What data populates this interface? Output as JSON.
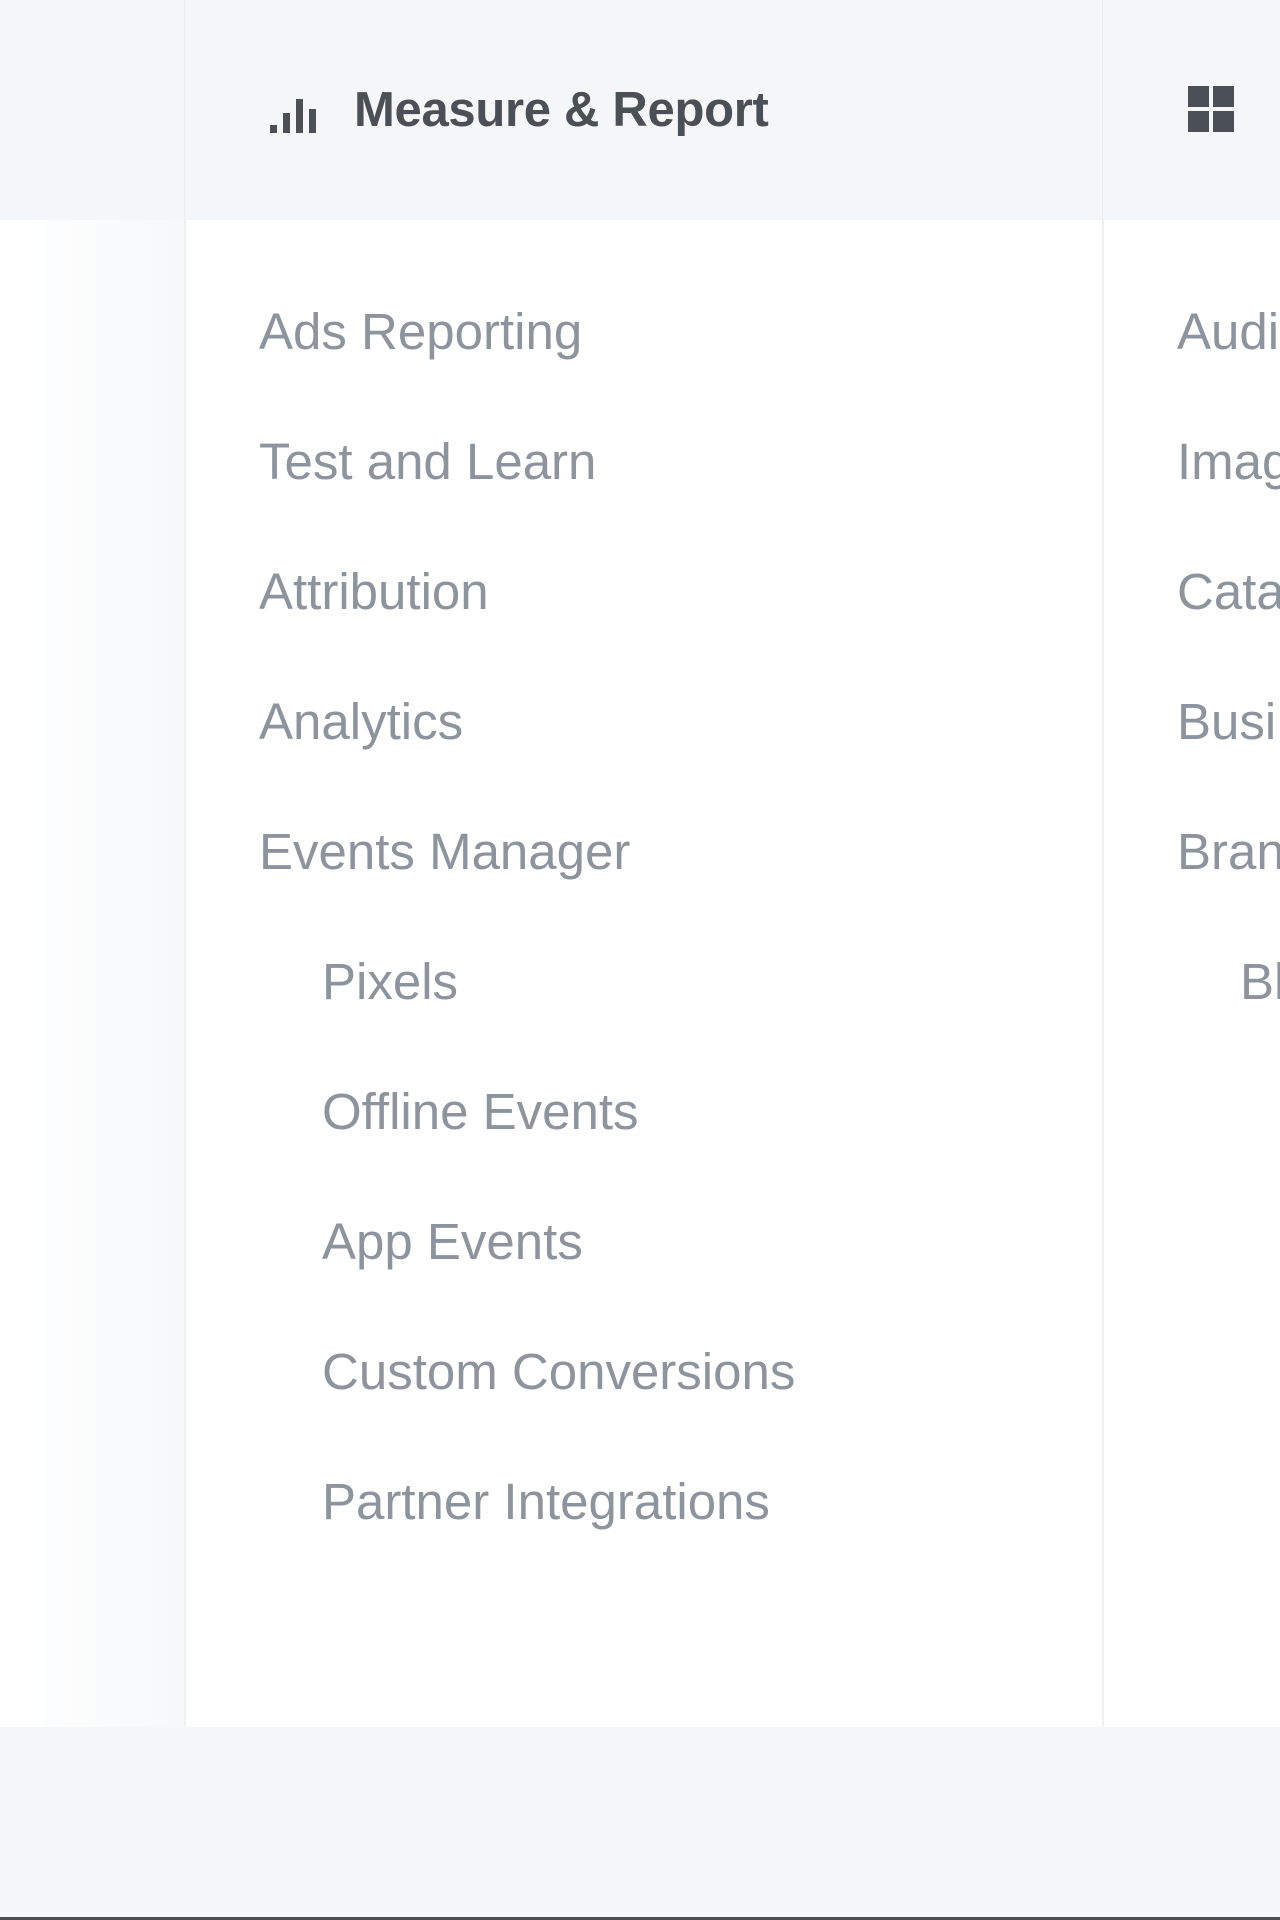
{
  "measure_column": {
    "title": "Measure & Report",
    "icon": "bar-chart-icon",
    "items": [
      {
        "label": "Ads Reporting"
      },
      {
        "label": "Test and Learn"
      },
      {
        "label": "Attribution"
      },
      {
        "label": "Analytics"
      },
      {
        "label": "Events Manager"
      }
    ],
    "sub_items": [
      {
        "label": "Pixels"
      },
      {
        "label": "Offline Events"
      },
      {
        "label": "App Events"
      },
      {
        "label": "Custom Conversions"
      },
      {
        "label": "Partner Integrations"
      }
    ]
  },
  "assets_column": {
    "icon": "grid-icon",
    "items": [
      {
        "label": "Audi"
      },
      {
        "label": "Imag"
      },
      {
        "label": "Cata"
      },
      {
        "label": "Busi"
      },
      {
        "label": "Bran"
      }
    ],
    "sub_items": [
      {
        "label": "Bl"
      }
    ]
  },
  "colors": {
    "header_bg": "#f5f6f7",
    "title_text": "#4b4f56",
    "item_text": "#8d949e",
    "divider": "#eef0f2"
  }
}
